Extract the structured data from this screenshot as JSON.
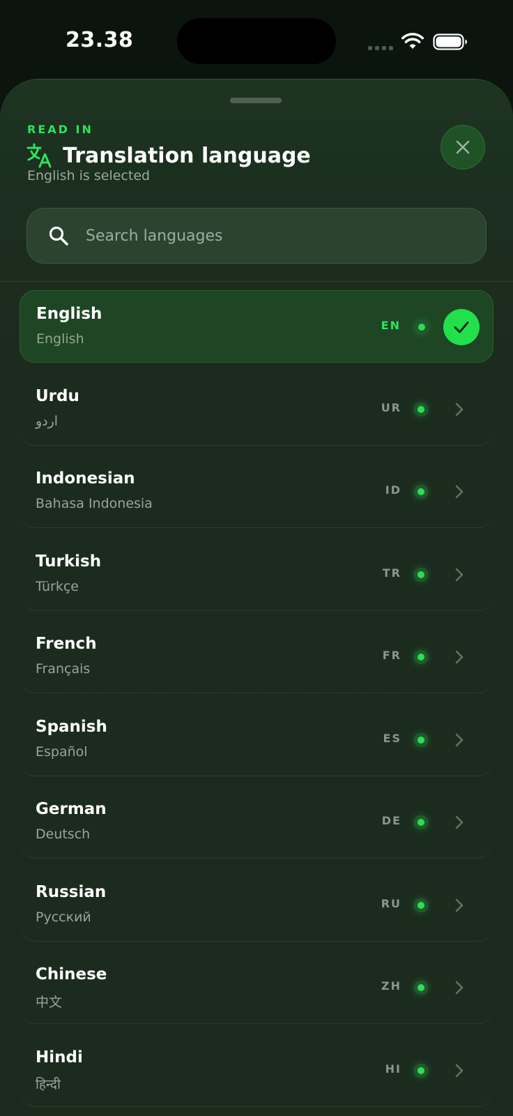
{
  "status_bar": {
    "time": "23.38"
  },
  "sheet": {
    "eyebrow": "READ IN",
    "title": "Translation language",
    "subtitle": "English is selected",
    "icons": {
      "title": "translate-icon",
      "close": "close-icon",
      "search": "search-icon",
      "selected": "check-icon",
      "row": "chevron-right-icon"
    }
  },
  "search": {
    "value": "",
    "placeholder": "Search languages"
  },
  "colors": {
    "accent": "#2fe25c",
    "sheet_background": "#1b2b1e",
    "selected_row": "#1e4624"
  },
  "languages": [
    {
      "name": "English",
      "native": "English",
      "code": "EN",
      "selected": true
    },
    {
      "name": "Urdu",
      "native": "اردو",
      "code": "UR",
      "selected": false
    },
    {
      "name": "Indonesian",
      "native": "Bahasa Indonesia",
      "code": "ID",
      "selected": false
    },
    {
      "name": "Turkish",
      "native": "Türkçe",
      "code": "TR",
      "selected": false
    },
    {
      "name": "French",
      "native": "Français",
      "code": "FR",
      "selected": false
    },
    {
      "name": "Spanish",
      "native": "Español",
      "code": "ES",
      "selected": false
    },
    {
      "name": "German",
      "native": "Deutsch",
      "code": "DE",
      "selected": false
    },
    {
      "name": "Russian",
      "native": "Русский",
      "code": "RU",
      "selected": false
    },
    {
      "name": "Chinese",
      "native": "中文",
      "code": "ZH",
      "selected": false
    },
    {
      "name": "Hindi",
      "native": "हिन्दी",
      "code": "HI",
      "selected": false
    }
  ]
}
